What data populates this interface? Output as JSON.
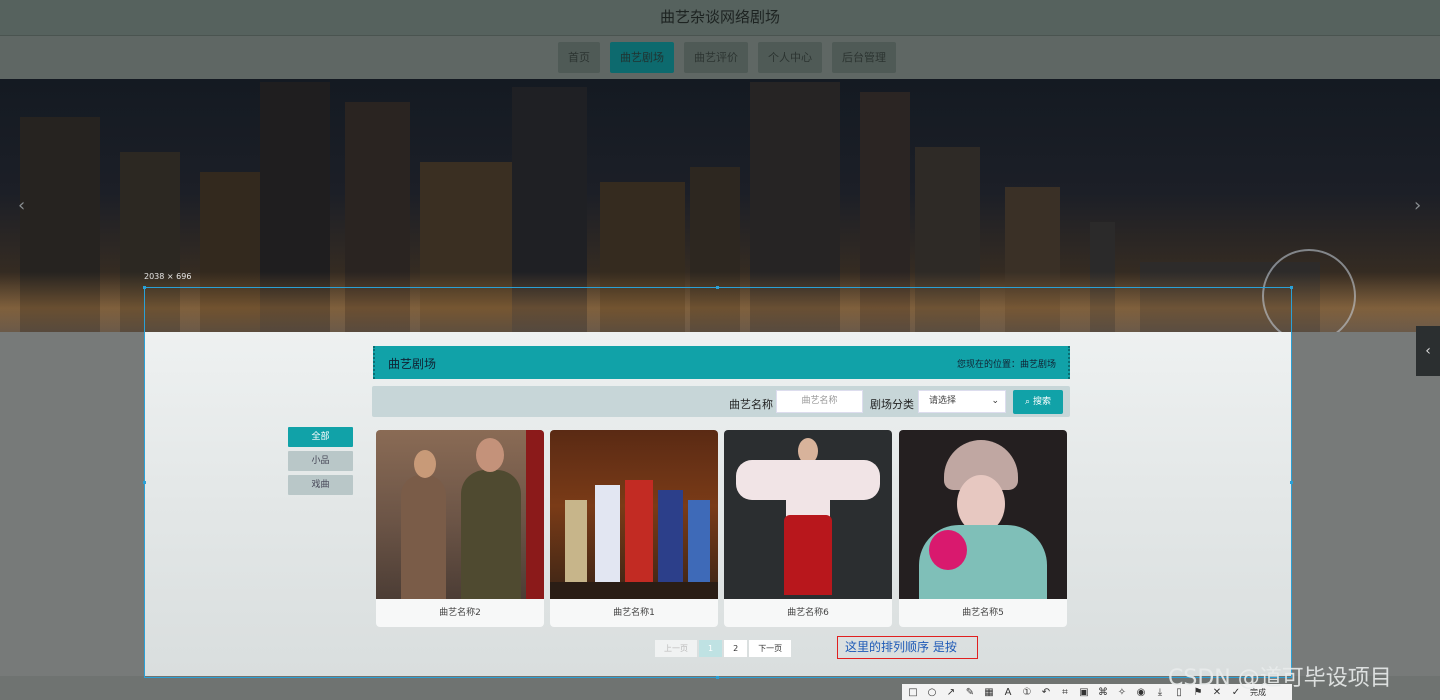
{
  "site": {
    "title": "曲艺杂谈网络剧场"
  },
  "nav": {
    "items": [
      "首页",
      "曲艺剧场",
      "曲艺评价",
      "个人中心",
      "后台管理"
    ]
  },
  "selection": {
    "dimensions": "2038 × 696"
  },
  "section": {
    "title": "曲艺剧场",
    "location": "您现在的位置：曲艺剧场"
  },
  "search": {
    "name_label": "曲艺名称",
    "name_placeholder": "曲艺名称",
    "category_label": "剧场分类",
    "category_value": "请选择",
    "button_label": "搜索"
  },
  "categories": [
    "全部",
    "小品",
    "戏曲"
  ],
  "cards": [
    {
      "name": "曲艺名称2"
    },
    {
      "name": "曲艺名称1"
    },
    {
      "name": "曲艺名称6"
    },
    {
      "name": "曲艺名称5"
    }
  ],
  "pagination": {
    "prev": "上一页",
    "pages": [
      "1",
      "2"
    ],
    "next": "下一页",
    "current": 1
  },
  "annotation": "这里的排列顺序 是按",
  "toolbar": {
    "done_label": "完成"
  },
  "watermark": "CSDN @道可毕设项目",
  "colors": {
    "accent": "#11a2a8",
    "annotation_border": "#e02020"
  }
}
